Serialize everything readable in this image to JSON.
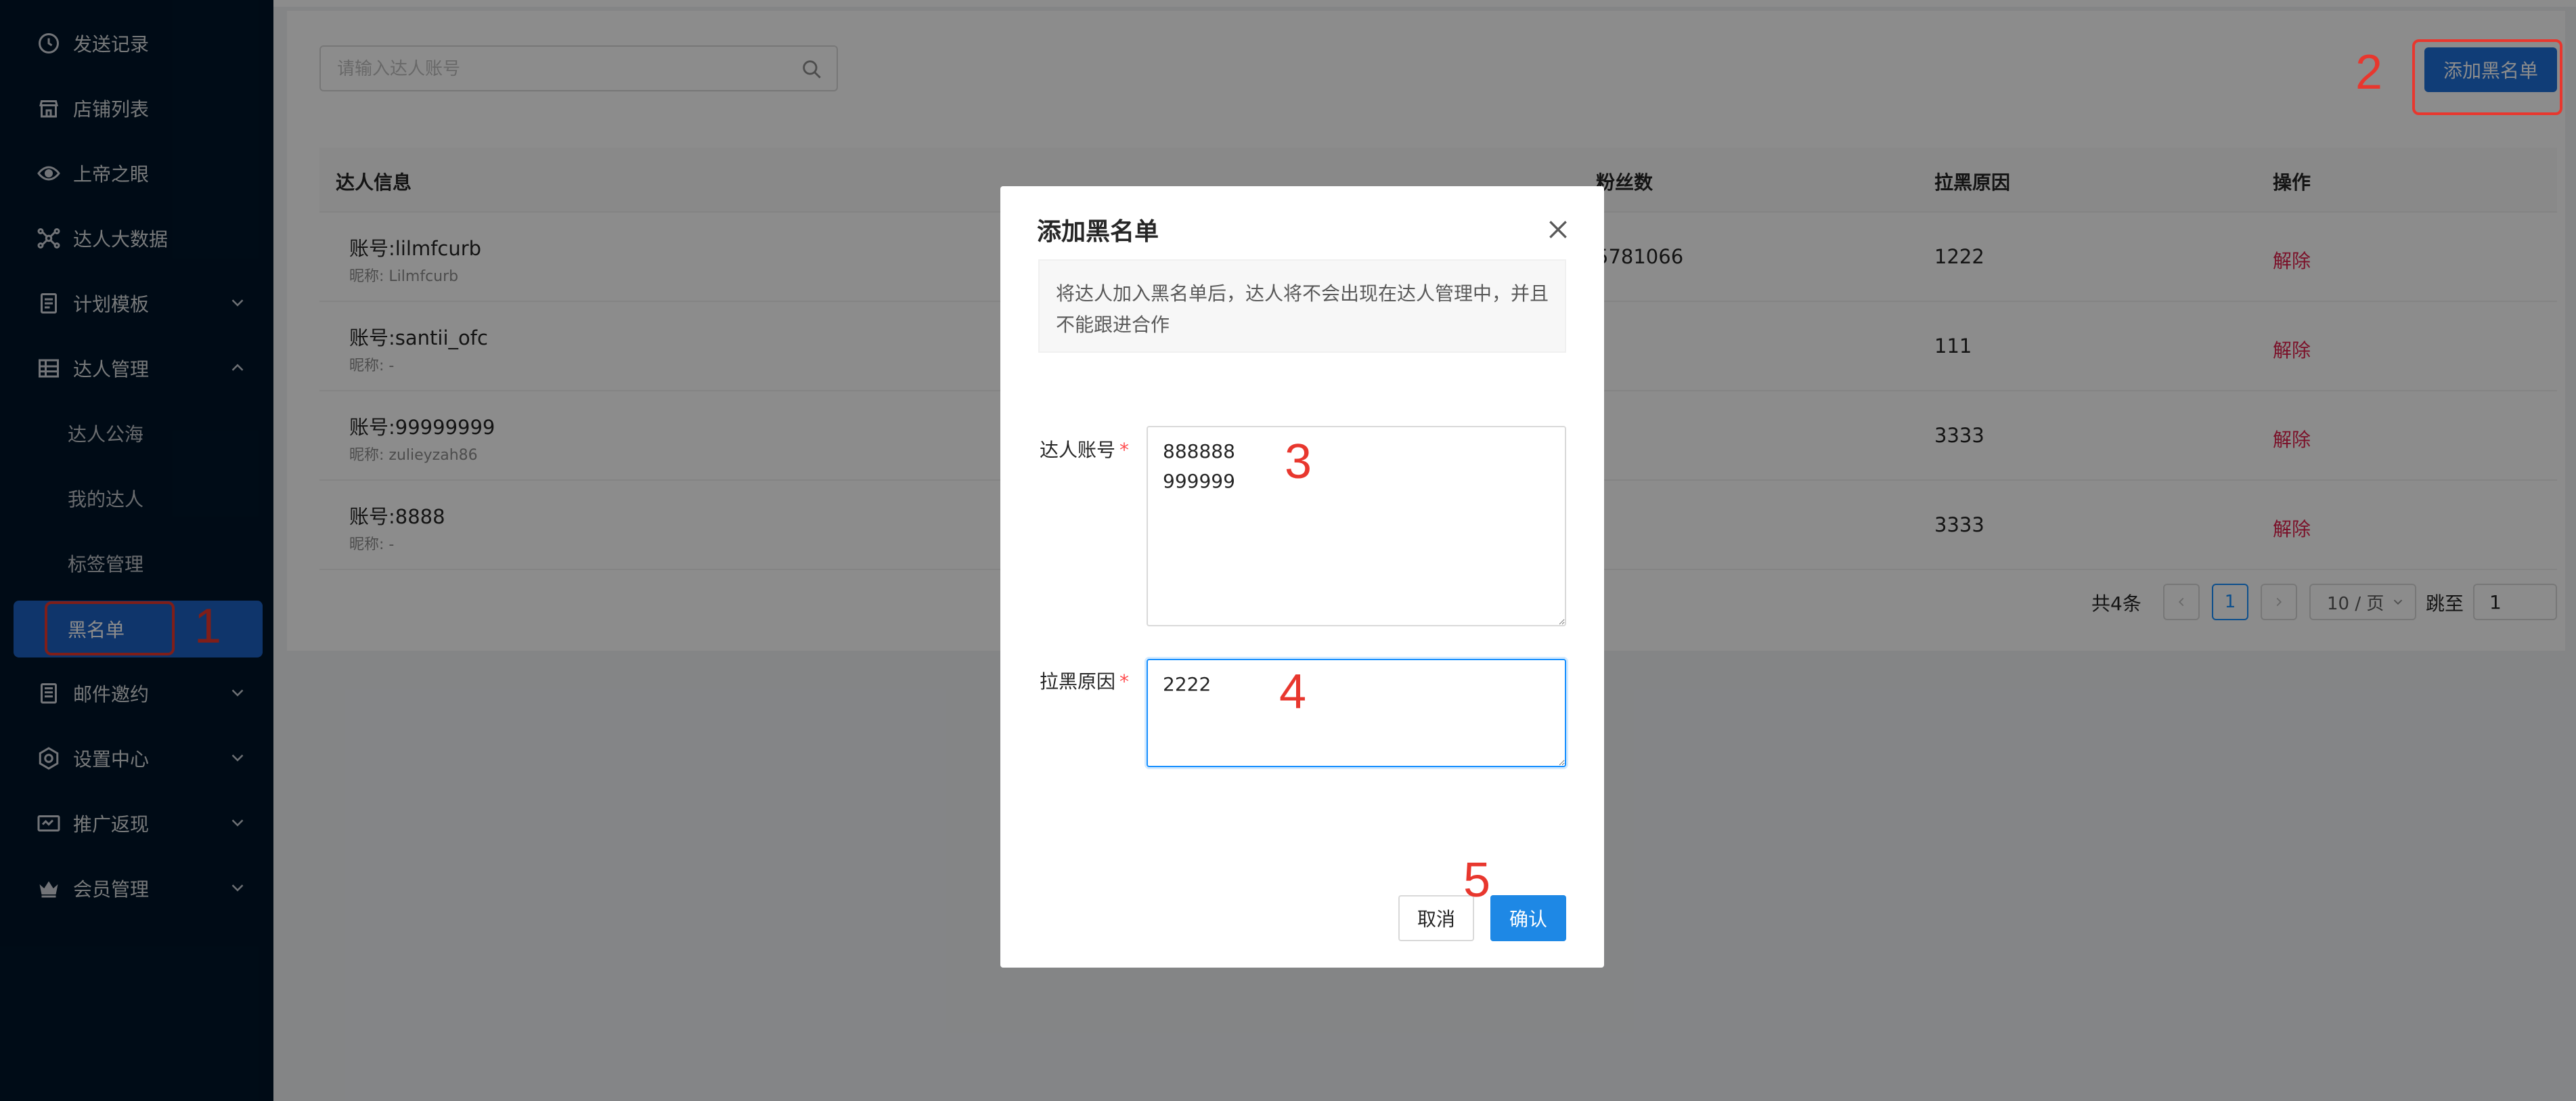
{
  "sidebar": {
    "items": [
      {
        "label": "发送记录",
        "icon": "clock-icon"
      },
      {
        "label": "店铺列表",
        "icon": "store-icon"
      },
      {
        "label": "上帝之眼",
        "icon": "eye-icon"
      },
      {
        "label": "达人大数据",
        "icon": "network-icon"
      },
      {
        "label": "计划模板",
        "icon": "document-icon"
      },
      {
        "label": "达人管理",
        "icon": "table-icon"
      }
    ],
    "sub_items": [
      "达人公海",
      "我的达人",
      "标签管理",
      "黑名单"
    ],
    "bottom_items": [
      {
        "label": "邮件邀约",
        "icon": "mail-doc-icon"
      },
      {
        "label": "设置中心",
        "icon": "settings-icon"
      },
      {
        "label": "推广返现",
        "icon": "cash-icon"
      },
      {
        "label": "会员管理",
        "icon": "crown-icon"
      }
    ]
  },
  "main": {
    "search_placeholder": "请输入达人账号",
    "add_button": "添加黑名单",
    "table": {
      "headers": [
        "达人信息",
        "粉丝数",
        "拉黑原因",
        "操作"
      ],
      "rows": [
        {
          "account": "账号:lilmfcurb",
          "nickname": "昵称: Lilmfcurb",
          "fans": "5781066",
          "reason": "1222",
          "action": "解除"
        },
        {
          "account": "账号:santii_ofc",
          "nickname": "昵称: -",
          "fans": "",
          "reason": "111",
          "action": "解除"
        },
        {
          "account": "账号:99999999",
          "nickname": "昵称: zulieyzah86",
          "fans": "",
          "reason": "3333",
          "action": "解除"
        },
        {
          "account": "账号:8888",
          "nickname": "昵称: -",
          "fans": "",
          "reason": "3333",
          "action": "解除"
        }
      ]
    },
    "pagination": {
      "total": "共4条",
      "current_page": "1",
      "page_size": "10 / 页",
      "jump_label": "跳至",
      "jump_value": "1"
    }
  },
  "modal": {
    "title": "添加黑名单",
    "tip": "将达人加入黑名单后，达人将不会出现在达人管理中，并且不能跟进合作",
    "account_label": "达人账号",
    "account_value": "888888\n999999",
    "reason_label": "拉黑原因",
    "reason_value": "2222",
    "required_mark": "*",
    "cancel": "取消",
    "confirm": "确认"
  },
  "annotations": {
    "n1": "1",
    "n2": "2",
    "n3": "3",
    "n4": "4",
    "n5": "5",
    "color": "#e8372e"
  },
  "colors": {
    "sidebar_bg": "#001529",
    "active_item": "#1d62c4",
    "primary": "#1e88e5",
    "danger": "#e0224e"
  }
}
